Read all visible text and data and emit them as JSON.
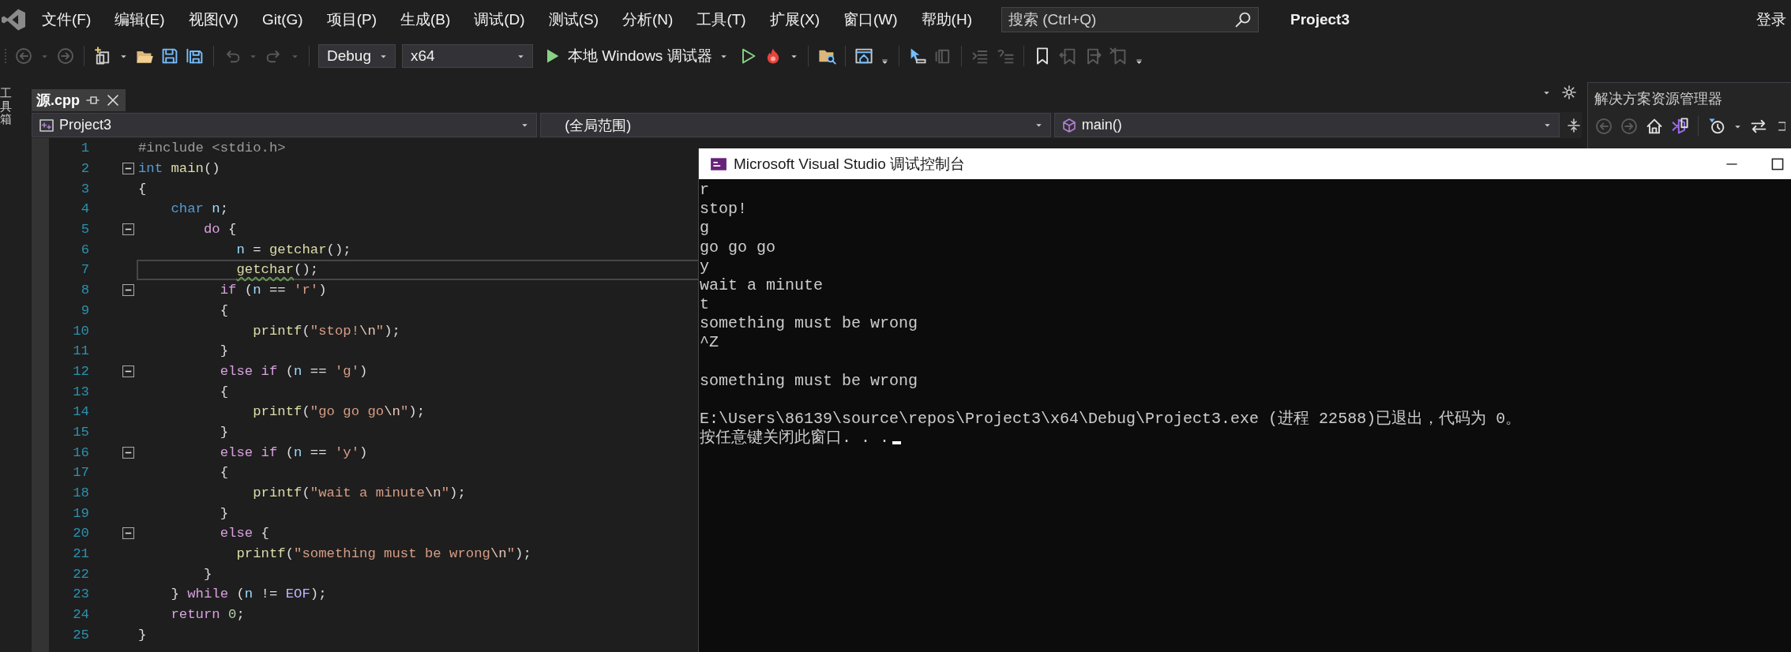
{
  "menu": [
    "文件(F)",
    "编辑(E)",
    "视图(V)",
    "Git(G)",
    "项目(P)",
    "生成(B)",
    "调试(D)",
    "测试(S)",
    "分析(N)",
    "工具(T)",
    "扩展(X)",
    "窗口(W)",
    "帮助(H)"
  ],
  "search": {
    "placeholder": "搜索 (Ctrl+Q)"
  },
  "solution_name": "Project3",
  "account": "登录",
  "toolbar": {
    "configuration": "Debug",
    "platform": "x64",
    "run_label": "本地 Windows 调试器"
  },
  "toolbox_label": "工具箱",
  "tabs": [
    {
      "label": "源.cpp",
      "selected": true
    }
  ],
  "nav_bar": {
    "project": "Project3",
    "scope": "(全局范围)",
    "member": "main()"
  },
  "code_lines": [
    {
      "number": "1",
      "fold": false,
      "current": false,
      "tokens": [
        {
          "kind": "pp",
          "text": "#include <stdio.h>"
        }
      ]
    },
    {
      "number": "2",
      "fold": true,
      "current": false,
      "tokens": [
        {
          "kind": "kw",
          "text": "int "
        },
        {
          "kind": "fn",
          "text": "main"
        },
        {
          "kind": "pl",
          "text": "()"
        }
      ]
    },
    {
      "number": "3",
      "fold": false,
      "current": false,
      "tokens": [
        {
          "kind": "pl",
          "text": "{"
        }
      ]
    },
    {
      "number": "4",
      "fold": false,
      "current": false,
      "tokens": [
        {
          "kind": "kw",
          "text": "    char "
        },
        {
          "kind": "var",
          "text": "n"
        },
        {
          "kind": "pl",
          "text": ";"
        }
      ]
    },
    {
      "number": "5",
      "fold": true,
      "current": false,
      "tokens": [
        {
          "kind": "ctl",
          "text": "        do"
        },
        {
          "kind": "pl",
          "text": " {"
        }
      ]
    },
    {
      "number": "6",
      "fold": false,
      "current": false,
      "tokens": [
        {
          "kind": "var",
          "text": "            n"
        },
        {
          "kind": "pl",
          "text": " = "
        },
        {
          "kind": "fn",
          "text": "getchar"
        },
        {
          "kind": "pl",
          "text": "();"
        }
      ]
    },
    {
      "number": "7",
      "fold": false,
      "current": true,
      "tokens": [
        {
          "kind": "warn",
          "text": "            getchar"
        },
        {
          "kind": "pl",
          "text": "();"
        }
      ]
    },
    {
      "number": "8",
      "fold": true,
      "current": false,
      "tokens": [
        {
          "kind": "ctl",
          "text": "          if"
        },
        {
          "kind": "pl",
          "text": " ("
        },
        {
          "kind": "var",
          "text": "n"
        },
        {
          "kind": "pl",
          "text": " == "
        },
        {
          "kind": "str",
          "text": "'r'"
        },
        {
          "kind": "pl",
          "text": ")"
        }
      ]
    },
    {
      "number": "9",
      "fold": false,
      "current": false,
      "tokens": [
        {
          "kind": "pl",
          "text": "          {"
        }
      ]
    },
    {
      "number": "10",
      "fold": false,
      "current": false,
      "tokens": [
        {
          "kind": "fn",
          "text": "              printf"
        },
        {
          "kind": "pl",
          "text": "("
        },
        {
          "kind": "str",
          "text": "\"stop!"
        },
        {
          "kind": "esc",
          "text": "\\n"
        },
        {
          "kind": "str",
          "text": "\""
        },
        {
          "kind": "pl",
          "text": ");"
        }
      ]
    },
    {
      "number": "11",
      "fold": false,
      "current": false,
      "tokens": [
        {
          "kind": "pl",
          "text": "          }"
        }
      ]
    },
    {
      "number": "12",
      "fold": true,
      "current": false,
      "tokens": [
        {
          "kind": "ctl",
          "text": "          else if"
        },
        {
          "kind": "pl",
          "text": " ("
        },
        {
          "kind": "var",
          "text": "n"
        },
        {
          "kind": "pl",
          "text": " == "
        },
        {
          "kind": "str",
          "text": "'g'"
        },
        {
          "kind": "pl",
          "text": ")"
        }
      ]
    },
    {
      "number": "13",
      "fold": false,
      "current": false,
      "tokens": [
        {
          "kind": "pl",
          "text": "          {"
        }
      ]
    },
    {
      "number": "14",
      "fold": false,
      "current": false,
      "tokens": [
        {
          "kind": "fn",
          "text": "              printf"
        },
        {
          "kind": "pl",
          "text": "("
        },
        {
          "kind": "str",
          "text": "\"go go go"
        },
        {
          "kind": "esc",
          "text": "\\n"
        },
        {
          "kind": "str",
          "text": "\""
        },
        {
          "kind": "pl",
          "text": ");"
        }
      ]
    },
    {
      "number": "15",
      "fold": false,
      "current": false,
      "tokens": [
        {
          "kind": "pl",
          "text": "          }"
        }
      ]
    },
    {
      "number": "16",
      "fold": true,
      "current": false,
      "tokens": [
        {
          "kind": "ctl",
          "text": "          else if"
        },
        {
          "kind": "pl",
          "text": " ("
        },
        {
          "kind": "var",
          "text": "n"
        },
        {
          "kind": "pl",
          "text": " == "
        },
        {
          "kind": "str",
          "text": "'y'"
        },
        {
          "kind": "pl",
          "text": ")"
        }
      ]
    },
    {
      "number": "17",
      "fold": false,
      "current": false,
      "tokens": [
        {
          "kind": "pl",
          "text": "          {"
        }
      ]
    },
    {
      "number": "18",
      "fold": false,
      "current": false,
      "tokens": [
        {
          "kind": "fn",
          "text": "              printf"
        },
        {
          "kind": "pl",
          "text": "("
        },
        {
          "kind": "str",
          "text": "\"wait a minute"
        },
        {
          "kind": "esc",
          "text": "\\n"
        },
        {
          "kind": "str",
          "text": "\""
        },
        {
          "kind": "pl",
          "text": ");"
        }
      ]
    },
    {
      "number": "19",
      "fold": false,
      "current": false,
      "tokens": [
        {
          "kind": "pl",
          "text": "          }"
        }
      ]
    },
    {
      "number": "20",
      "fold": true,
      "current": false,
      "tokens": [
        {
          "kind": "ctl",
          "text": "          else"
        },
        {
          "kind": "pl",
          "text": " {"
        }
      ]
    },
    {
      "number": "21",
      "fold": false,
      "current": false,
      "tokens": [
        {
          "kind": "fn",
          "text": "            printf"
        },
        {
          "kind": "pl",
          "text": "("
        },
        {
          "kind": "str",
          "text": "\"something must be wrong"
        },
        {
          "kind": "esc",
          "text": "\\n"
        },
        {
          "kind": "str",
          "text": "\""
        },
        {
          "kind": "pl",
          "text": ");"
        }
      ]
    },
    {
      "number": "22",
      "fold": false,
      "current": false,
      "tokens": [
        {
          "kind": "pl",
          "text": "        }"
        }
      ]
    },
    {
      "number": "23",
      "fold": false,
      "current": false,
      "tokens": [
        {
          "kind": "pl",
          "text": "    } "
        },
        {
          "kind": "ctl",
          "text": "while"
        },
        {
          "kind": "pl",
          "text": " ("
        },
        {
          "kind": "var",
          "text": "n"
        },
        {
          "kind": "pl",
          "text": " != "
        },
        {
          "kind": "mac",
          "text": "EOF"
        },
        {
          "kind": "pl",
          "text": ");"
        }
      ]
    },
    {
      "number": "24",
      "fold": false,
      "current": false,
      "tokens": [
        {
          "kind": "ctl",
          "text": "    return "
        },
        {
          "kind": "num",
          "text": "0"
        },
        {
          "kind": "pl",
          "text": ";"
        }
      ]
    },
    {
      "number": "25",
      "fold": false,
      "current": false,
      "tokens": [
        {
          "kind": "pl",
          "text": "}"
        }
      ]
    }
  ],
  "solution_explorer": {
    "title": "解决方案资源管理器"
  },
  "console": {
    "title": "Microsoft Visual Studio 调试控制台",
    "cursor_visible": true,
    "blocks": [
      {
        "lines": [
          "r",
          "stop!",
          "g",
          "go go go",
          "y",
          "wait a minute",
          "t",
          "something must be wrong",
          "^Z"
        ]
      },
      {
        "lines": [
          "something must be wrong"
        ]
      },
      {
        "lines": [
          "E:\\Users\\86139\\source\\repos\\Project3\\x64\\Debug\\Project3.exe (进程 22588)已退出，代码为 0。",
          "按任意键关闭此窗口. . ."
        ]
      }
    ]
  }
}
